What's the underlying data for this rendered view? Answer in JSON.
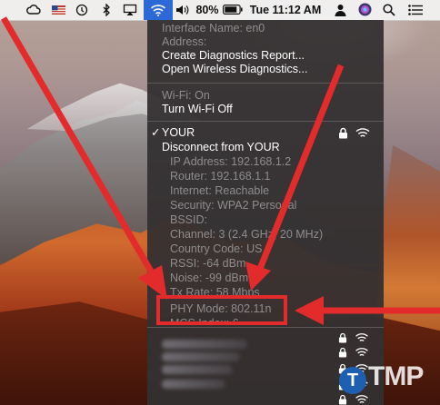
{
  "menubar": {
    "battery_percent": "80%",
    "clock": "Tue 11:12 AM",
    "icons": [
      "cloud-icon",
      "us-flag-icon",
      "time-machine-icon",
      "bluetooth-icon",
      "airplay-icon",
      "wifi-icon",
      "volume-icon",
      "battery-icon",
      "user-icon",
      "siri-icon",
      "search-icon",
      "menu-list-icon"
    ]
  },
  "wifi_menu": {
    "interface_name": "Interface Name: en0",
    "address": "Address:",
    "create_diagnostics": "Create Diagnostics Report...",
    "open_diagnostics": "Open Wireless Diagnostics...",
    "wifi_status": "Wi-Fi: On",
    "turn_off": "Turn Wi-Fi Off",
    "checkmark": "✓",
    "network_name": "YOUR",
    "disconnect": "Disconnect from YOUR",
    "details": [
      "IP Address: 192.168.1.2",
      "Router: 192.168.1.1",
      "Internet: Reachable",
      "Security: WPA2 Personal",
      "BSSID:",
      "Channel: 3 (2.4 GHz, 20 MHz)",
      "Country Code: US",
      "RSSI: -64 dBm",
      "Noise: -99 dBm",
      "Tx Rate: 58 Mbps",
      "PHY Mode: 802.11n",
      "MCS Index: 6"
    ]
  },
  "annotation": {
    "color": "#e42b2b"
  },
  "watermark": {
    "letter": "T",
    "text": "TMP"
  },
  "colors": {
    "menu_bg": "#343032",
    "dim_text": "#8e8c8d",
    "selection_blue": "#2c69d6"
  }
}
